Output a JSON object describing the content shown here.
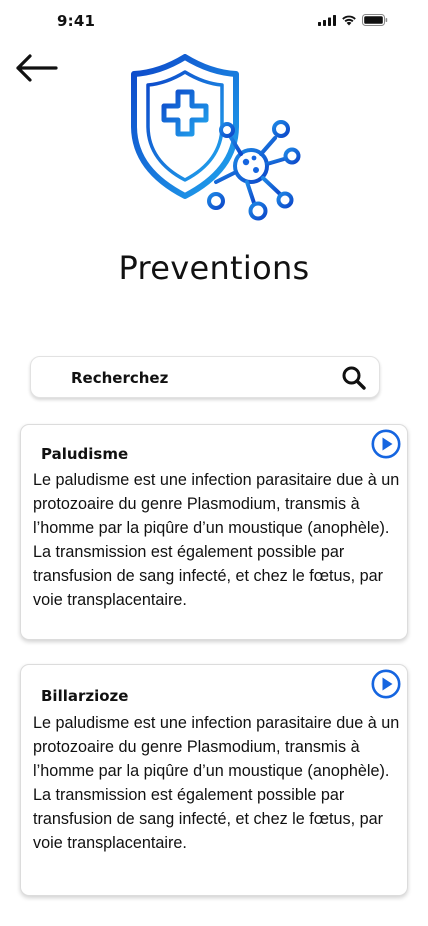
{
  "status_bar": {
    "time": "9:41"
  },
  "header": {
    "title": "Preventions"
  },
  "search": {
    "placeholder": "Recherchez"
  },
  "cards": [
    {
      "title": "Paludisme",
      "text": "Le paludisme est une infection parasitaire due à un protozoaire du genre Plasmodium, transmis à l’homme par la piqûre d’un moustique (anophèle). La transmission est également possible par transfusion de sang infecté, et chez le fœtus, par voie transplacentaire."
    },
    {
      "title": "Billarzioze",
      "text": "Le paludisme est une infection parasitaire due à un protozoaire du genre Plasmodium, transmis à l’homme par la piqûre d’un moustique (anophèle). La transmission est également possible par transfusion de sang infecté, et chez le fœtus, par voie transplacentaire."
    }
  ],
  "colors": {
    "accent_blue": "#1565e0",
    "accent_light_blue": "#25a9ef"
  }
}
